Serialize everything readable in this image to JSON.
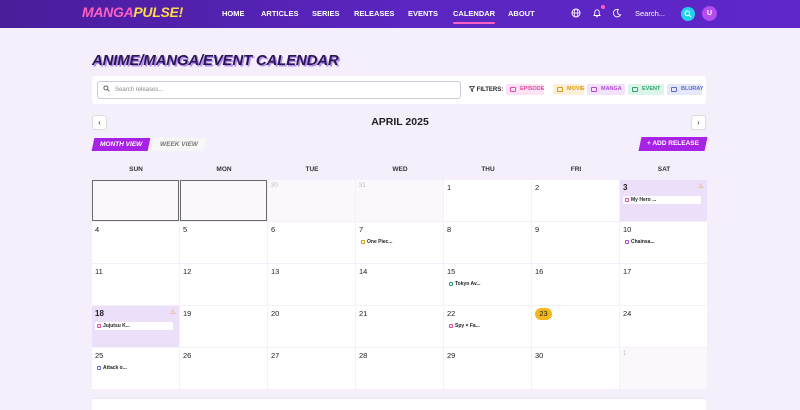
{
  "nav": {
    "logo_a": "MANGA",
    "logo_b": "PULSE!",
    "links": [
      "HOME",
      "ARTICLES",
      "SERIES",
      "RELEASES",
      "EVENTS",
      "CALENDAR",
      "ABOUT"
    ],
    "active": "CALENDAR",
    "search_placeholder": "Search...",
    "avatar_initial": "U"
  },
  "page": {
    "title": "ANIME/MANGA/EVENT CALENDAR",
    "search_placeholder": "Search releases...",
    "filters_label": "FILTERS:",
    "filters": [
      {
        "label": "EPISODE",
        "color": "#e64aa3",
        "bg": "#fbe3f3"
      },
      {
        "label": "MOVIE",
        "color": "#d99a12",
        "bg": "#fdf0d8"
      },
      {
        "label": "MANGA",
        "color": "#b04ad8",
        "bg": "#f3e2fb"
      },
      {
        "label": "EVENT",
        "color": "#28a86e",
        "bg": "#ddf4ea"
      },
      {
        "label": "BLURAY",
        "color": "#5a6bd8",
        "bg": "#e6e8fa"
      }
    ]
  },
  "calendar": {
    "month_label": "APRIL 2025",
    "month_view": "MONTH VIEW",
    "week_view": "WEEK VIEW",
    "add_release": "+ ADD RELEASE",
    "weekdays": [
      "SUN",
      "MON",
      "TUE",
      "WED",
      "THU",
      "FRI",
      "SAT"
    ],
    "today": "23",
    "weeks": [
      [
        {
          "day": "",
          "other": true,
          "selected": true
        },
        {
          "day": "",
          "other": true,
          "selected": true
        },
        {
          "day": "30",
          "other": true
        },
        {
          "day": "31",
          "other": true
        },
        {
          "day": "1"
        },
        {
          "day": "2"
        },
        {
          "day": "3",
          "hl": true,
          "fire": true,
          "event": {
            "title": "My Hero ...",
            "kind": "EPISODE"
          }
        }
      ],
      [
        {
          "day": "4"
        },
        {
          "day": "5"
        },
        {
          "day": "6"
        },
        {
          "day": "7",
          "event": {
            "title": "One Piec...",
            "kind": "MOVIE"
          }
        },
        {
          "day": "8"
        },
        {
          "day": "9"
        },
        {
          "day": "10",
          "event": {
            "title": "Chainsa...",
            "kind": "MANGA"
          }
        }
      ],
      [
        {
          "day": "11"
        },
        {
          "day": "12"
        },
        {
          "day": "13"
        },
        {
          "day": "14"
        },
        {
          "day": "15",
          "event": {
            "title": "Tokyo Av...",
            "kind": "EVENT"
          }
        },
        {
          "day": "16"
        },
        {
          "day": "17"
        }
      ],
      [
        {
          "day": "18",
          "hl": true,
          "fire": true,
          "event": {
            "title": "Jujutsu K...",
            "kind": "EPISODE"
          }
        },
        {
          "day": "19"
        },
        {
          "day": "20"
        },
        {
          "day": "21"
        },
        {
          "day": "22",
          "event": {
            "title": "Spy × Fa...",
            "kind": "EPISODE"
          }
        },
        {
          "day": "23",
          "today": true
        },
        {
          "day": "24"
        }
      ],
      [
        {
          "day": "25",
          "event": {
            "title": "Attack o...",
            "kind": "BLURAY"
          }
        },
        {
          "day": "26"
        },
        {
          "day": "27"
        },
        {
          "day": "28"
        },
        {
          "day": "29"
        },
        {
          "day": "30"
        },
        {
          "day": "1",
          "other": true
        }
      ]
    ]
  }
}
